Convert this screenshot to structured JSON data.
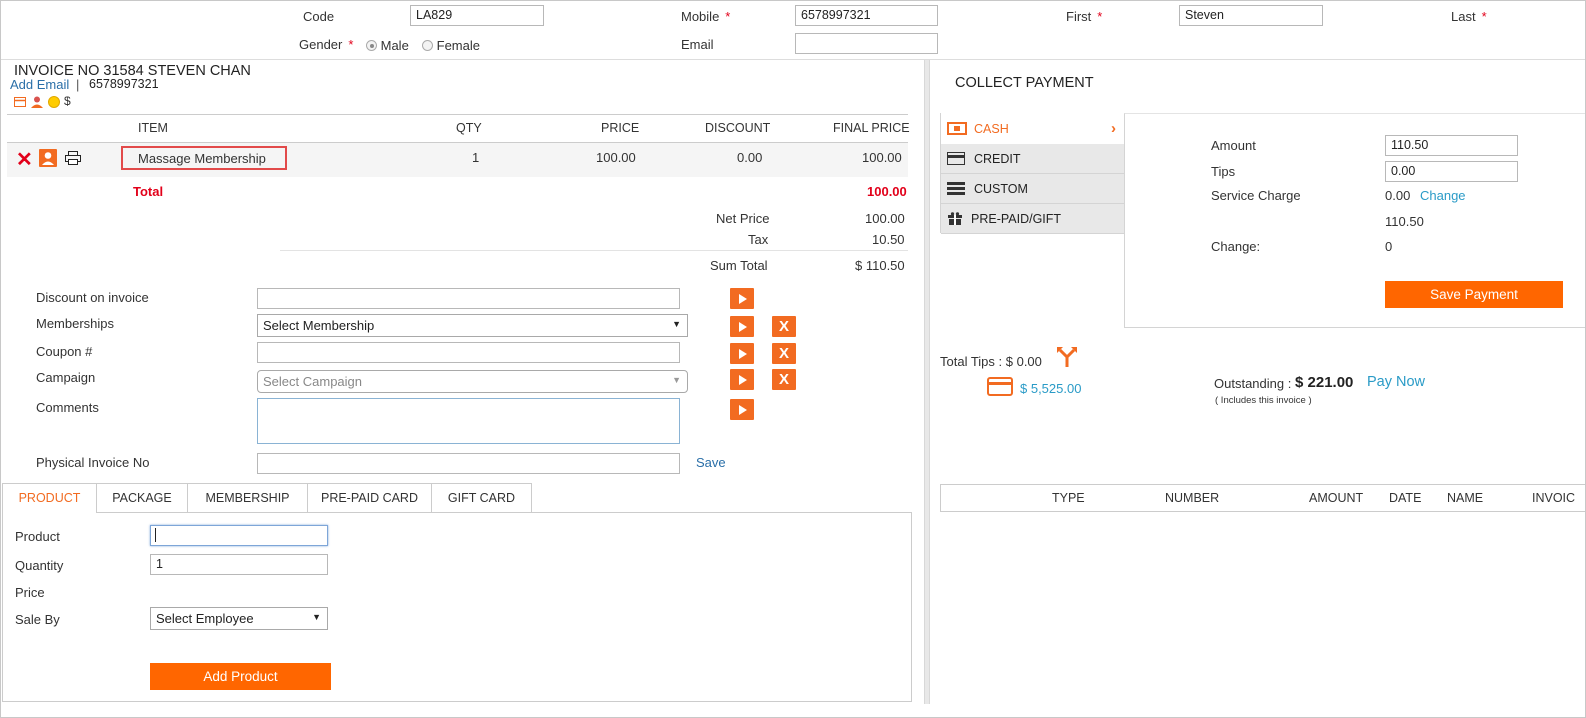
{
  "customer": {
    "code_label": "Code",
    "code_value": "LA829",
    "mobile_label": "Mobile",
    "mobile_value": "6578997321",
    "first_label": "First",
    "first_value": "Steven",
    "last_label": "Last",
    "gender_label": "Gender",
    "gender_options": [
      "Male",
      "Female"
    ],
    "gender_selected": "Male",
    "email_label": "Email",
    "email_value": "",
    "required_mark": "*"
  },
  "invoice": {
    "title": "INVOICE NO 31584  STEVEN CHAN",
    "add_email_link": "Add Email",
    "separator": "|",
    "phone": "6578997321",
    "currency_symbol": "$",
    "columns": [
      "ITEM",
      "QTY",
      "PRICE",
      "DISCOUNT",
      "FINAL PRICE"
    ],
    "items": [
      {
        "item": "Massage Membership",
        "qty": "1",
        "price": "100.00",
        "discount": "0.00",
        "final_price": "100.00"
      }
    ],
    "total_label": "Total",
    "total_value": "100.00",
    "net_price_label": "Net Price",
    "net_price_value": "100.00",
    "tax_label": "Tax",
    "tax_value": "10.50",
    "sum_total_label": "Sum Total",
    "sum_total_value": "$ 110.50"
  },
  "adjustments": {
    "discount_label": "Discount on invoice",
    "discount_value": "",
    "memberships_label": "Memberships",
    "memberships_selected": "Select Membership",
    "coupon_label": "Coupon #",
    "coupon_value": "",
    "campaign_label": "Campaign",
    "campaign_placeholder": "Select Campaign",
    "comments_label": "Comments",
    "comments_value": "",
    "physical_invoice_label": "Physical Invoice No",
    "physical_invoice_value": "",
    "save_link": "Save",
    "x_label": "X"
  },
  "tabs": [
    "PRODUCT",
    "PACKAGE",
    "MEMBERSHIP",
    "PRE-PAID CARD",
    "GIFT CARD"
  ],
  "active_tab": "PRODUCT",
  "product_form": {
    "product_label": "Product",
    "product_value": "",
    "quantity_label": "Quantity",
    "quantity_value": "1",
    "price_label": "Price",
    "sale_by_label": "Sale By",
    "sale_by_selected": "Select Employee",
    "add_button": "Add Product"
  },
  "payment": {
    "title": "COLLECT PAYMENT",
    "methods": [
      "CASH",
      "CREDIT",
      "CUSTOM",
      "PRE-PAID/GIFT"
    ],
    "active_method": "CASH",
    "amount_label": "Amount",
    "amount_value": "110.50",
    "tips_label": "Tips",
    "tips_value": "0.00",
    "service_charge_label": "Service Charge",
    "service_charge_value": "0.00",
    "change_link": "Change",
    "subtotal_value": "110.50",
    "change_label": "Change:",
    "change_value": "0",
    "save_button": "Save Payment",
    "total_tips": "Total Tips : $ 0.00",
    "card_balance": "$ 5,525.00",
    "outstanding_label": "Outstanding :",
    "outstanding_value": "$ 221.00",
    "pay_now": "Pay Now",
    "outstanding_note": "( Includes this invoice )",
    "history_columns": [
      "TYPE",
      "NUMBER",
      "AMOUNT",
      "DATE",
      "NAME",
      "INVOIC"
    ]
  },
  "colors": {
    "accent": "#f26b21",
    "button": "#ff6600",
    "link": "#2a9bc7",
    "total_red": "#e2001a"
  }
}
